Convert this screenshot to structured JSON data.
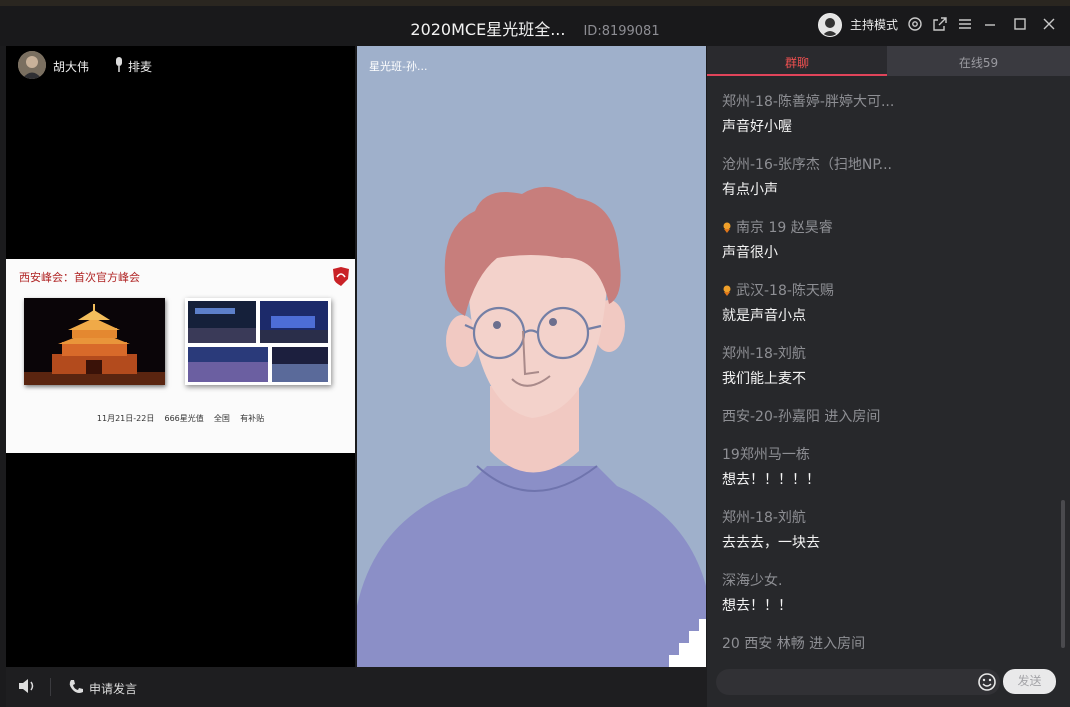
{
  "window": {
    "title": "2020MCE星光班全...",
    "room_id": "ID:8199081",
    "host_mode_label": "主持模式"
  },
  "teacher_video": {
    "name": "胡大伟",
    "mic_label": "排麦"
  },
  "slide": {
    "title": "西安峰会：首次官方峰会",
    "caption": "11月21日-22日    666星光值    全国    有补贴"
  },
  "student_video": {
    "label": "星光班-孙..."
  },
  "chat": {
    "tabs": [
      {
        "label": "群聊",
        "active": true
      },
      {
        "label": "在线59",
        "active": false
      }
    ],
    "messages": [
      {
        "sender": "郑州-18-陈善婷-胖婷大可...",
        "text": "声音好小喔",
        "badge": false
      },
      {
        "sender": "沧州-16-张序杰（扫地NP...",
        "text": "有点小声",
        "badge": false
      },
      {
        "sender": "南京 19 赵昊睿",
        "text": "声音很小",
        "badge": true
      },
      {
        "sender": "武汉-18-陈天赐",
        "text": "就是声音小点",
        "badge": true
      },
      {
        "sender": "郑州-18-刘航",
        "text": "我们能上麦不",
        "badge": false
      },
      {
        "sender": "西安-20-孙嘉阳 进入房间",
        "text": null,
        "badge": false
      },
      {
        "sender": "19郑州马一栋",
        "text": "想去！！！！！",
        "badge": false
      },
      {
        "sender": "郑州-18-刘航",
        "text": "去去去，一块去",
        "badge": false
      },
      {
        "sender": "深海少女.",
        "text": "想去！！！",
        "badge": false
      },
      {
        "sender": "20 西安 林畅 进入房间",
        "text": null,
        "badge": false
      }
    ],
    "input_value": "",
    "send_label": "发送"
  },
  "bottom_bar": {
    "apply_label": "申请发言"
  },
  "colors": {
    "accent": "#e0445a",
    "avatar_bg": "#9fb0cb",
    "chat_bg": "#27282b"
  }
}
